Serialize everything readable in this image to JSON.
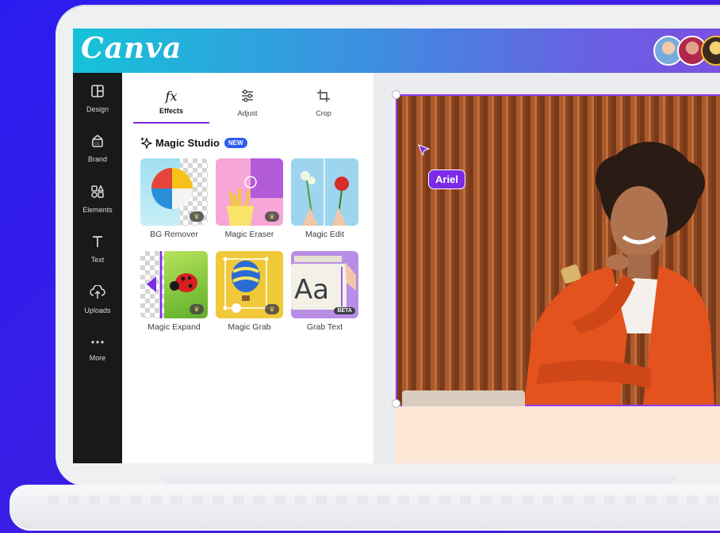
{
  "app": {
    "logo": "Canva"
  },
  "nav": {
    "items": [
      {
        "label": "Design",
        "icon": "layout-icon"
      },
      {
        "label": "Brand",
        "icon": "brand-icon"
      },
      {
        "label": "Elements",
        "icon": "shapes-icon"
      },
      {
        "label": "Text",
        "icon": "text-icon"
      },
      {
        "label": "Uploads",
        "icon": "cloud-upload-icon"
      },
      {
        "label": "More",
        "icon": "more-icon"
      }
    ]
  },
  "panel": {
    "tabs": [
      {
        "label": "Effects",
        "icon": "fx-icon",
        "active": true
      },
      {
        "label": "Adjust",
        "icon": "sliders-icon",
        "active": false
      },
      {
        "label": "Crop",
        "icon": "crop-icon",
        "active": false
      }
    ],
    "section_title": "Magic Studio",
    "section_badge": "NEW",
    "tools": [
      {
        "label": "BG Remover",
        "pro": true
      },
      {
        "label": "Magic Eraser",
        "pro": true
      },
      {
        "label": "Magic Edit",
        "pro": false
      },
      {
        "label": "Magic Expand",
        "pro": true
      },
      {
        "label": "Magic Grab",
        "pro": true
      },
      {
        "label": "Grab Text",
        "badge": "BETA"
      }
    ]
  },
  "canvas": {
    "collaborator_cursor_label": "Ariel"
  },
  "colors": {
    "accent": "#7d2ae8",
    "nav_bg": "#18191b",
    "badge_blue": "#2d5cf0"
  }
}
